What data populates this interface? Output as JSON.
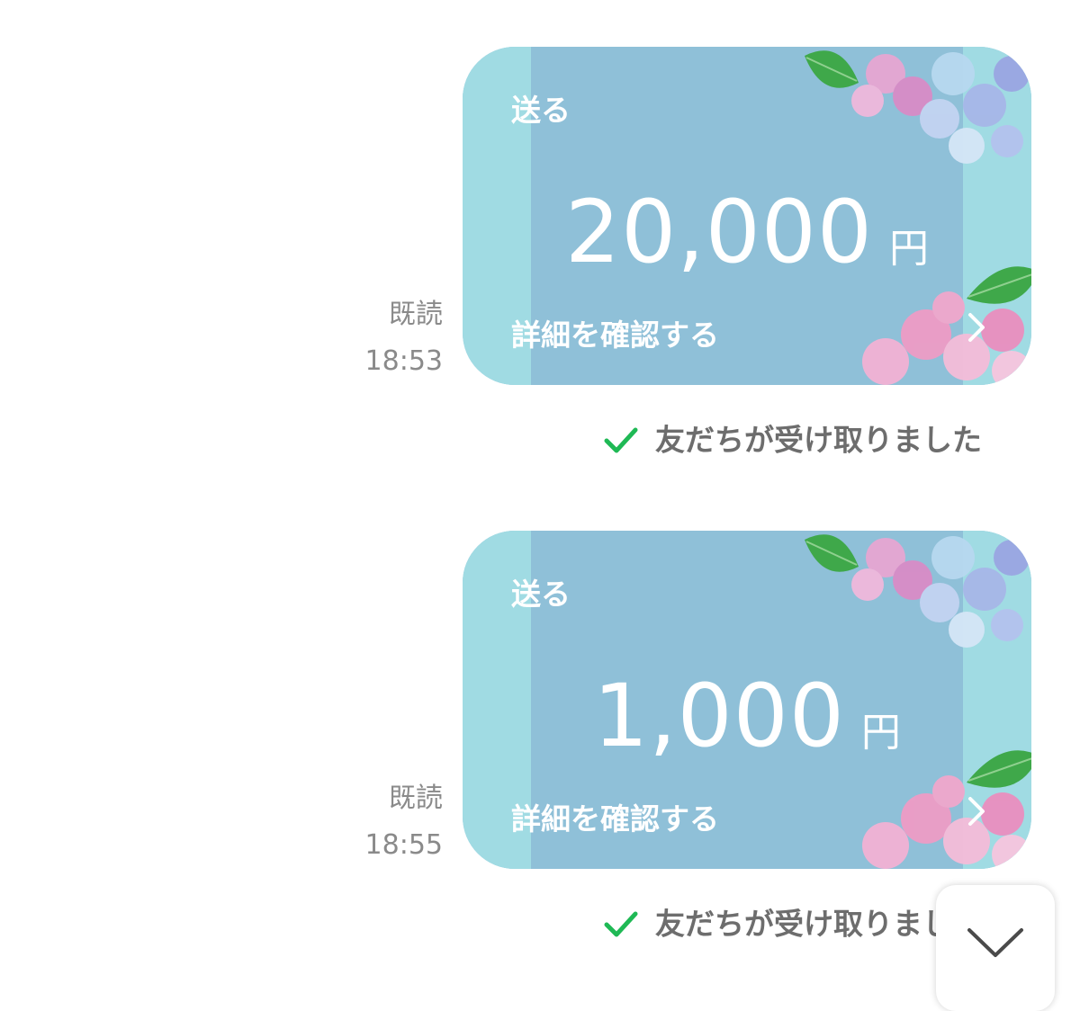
{
  "messages": [
    {
      "read_label": "既読",
      "time": "18:53",
      "card": {
        "label": "送る",
        "amount": "20,000",
        "currency": "円",
        "detail_link": "詳細を確認する"
      },
      "status": "友だちが受け取りました"
    },
    {
      "read_label": "既読",
      "time": "18:55",
      "card": {
        "label": "送る",
        "amount": "1,000",
        "currency": "円",
        "detail_link": "詳細を確認する"
      },
      "status": "友だちが受け取りました"
    }
  ],
  "colors": {
    "card_background": "#8fc0d8",
    "card_side_stripes": "#a0dbe3",
    "check_green": "#1fb955",
    "meta_text": "#8a8a8a",
    "status_text": "#6d6d6d"
  },
  "icons": {
    "status": "checkmark-icon",
    "card_link": "chevron-right-icon",
    "scroll": "chevron-down-icon",
    "decoration": "hydrangea-flowers"
  }
}
